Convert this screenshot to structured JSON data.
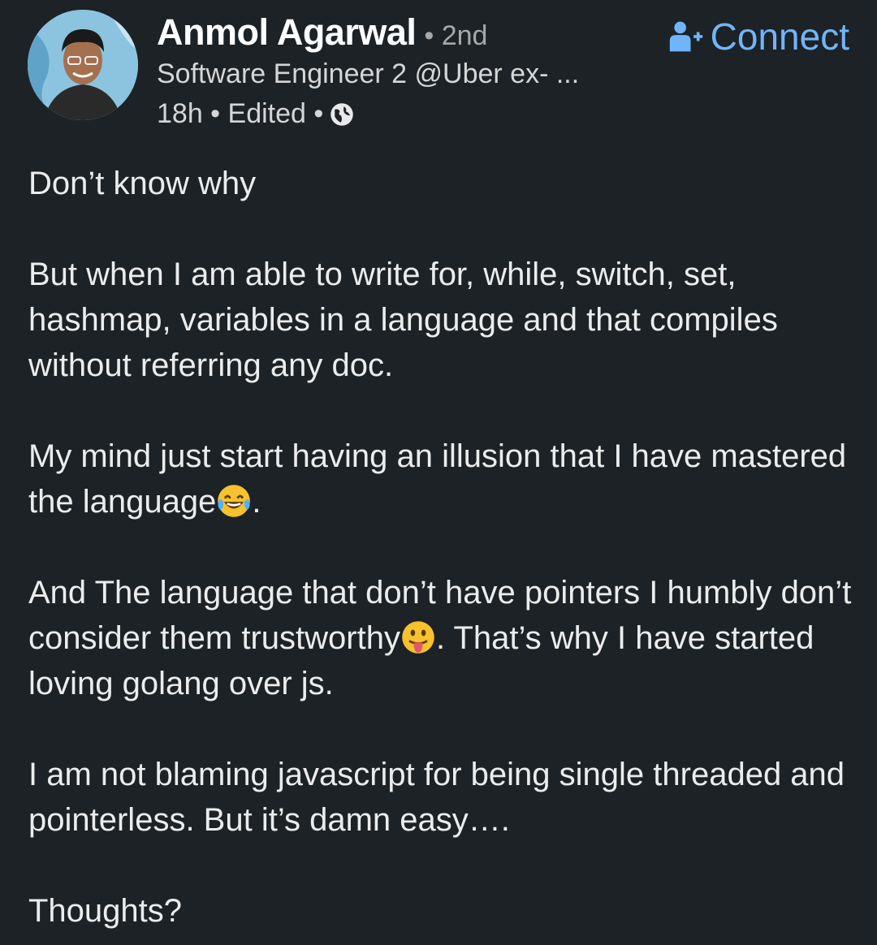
{
  "post": {
    "author": {
      "name": "Anmol Agarwal",
      "degree": "• 2nd",
      "headline": "Software Engineer 2 @Uber ex- ...",
      "time": "18h",
      "edited": "Edited",
      "visibility_icon": "globe-icon"
    },
    "connect_label": "Connect",
    "connect_icon": "add-person-icon",
    "paragraphs": {
      "p1": "Don’t know why",
      "p2": "But when I am able to write for, while, switch, set, hashmap, variables in a language and that compiles without referring any doc.",
      "p3a": "My mind just start having an illusion that I have mastered the language",
      "p3b": ".",
      "p4a": "And The language that don’t have pointers I humbly don’t consider them trustworthy",
      "p4b": ". That’s why I have started loving golang over js.",
      "p5": "I am not blaming javascript for being single threaded and pointerless. But it’s damn easy….",
      "p6": "Thoughts?"
    },
    "emojis": [
      "laughing-tears-emoji",
      "tongue-out-emoji"
    ]
  },
  "colors": {
    "background": "#1d2226",
    "link": "#70b5f9",
    "text": "#ececec",
    "muted": "#a8a8a8"
  }
}
